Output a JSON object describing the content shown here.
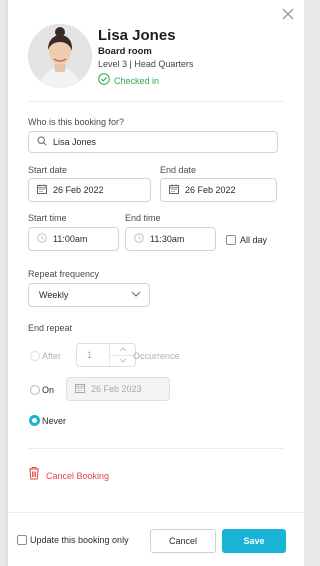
{
  "header": {
    "name": "Lisa Jones",
    "room": "Board room",
    "location": "Level 3 | Head Quarters",
    "status": "Checked in",
    "status_color": "#2fa84f"
  },
  "booking_for": {
    "label": "Who is this booking for?",
    "value": "Lisa Jones"
  },
  "dates": {
    "start_label": "Start date",
    "start_value": "26 Feb 2022",
    "end_label": "End date",
    "end_value": "26 Feb 2022"
  },
  "times": {
    "start_label": "Start time",
    "start_value": "11:00am",
    "end_label": "End time",
    "end_value": "11:30am",
    "all_day_label": "All day",
    "all_day_checked": false
  },
  "repeat": {
    "label": "Repeat frequency",
    "selected": "Weekly"
  },
  "end_repeat": {
    "label": "End repeat",
    "after_label": "After",
    "after_value": "1",
    "occurrence_label": "Occurrence",
    "on_label": "On",
    "on_date": "26 Feb 2023",
    "never_label": "Never",
    "selected": "Never"
  },
  "cancel_booking_label": "Cancel Booking",
  "footer": {
    "update_only_label": "Update this booking only",
    "cancel_label": "Cancel",
    "save_label": "Save"
  },
  "colors": {
    "accent": "#19b3d6",
    "danger": "#e14646"
  },
  "icons": [
    "close-icon",
    "check-circle-icon",
    "search-icon",
    "calendar-icon",
    "clock-icon",
    "chevron-down-icon",
    "trash-icon"
  ]
}
